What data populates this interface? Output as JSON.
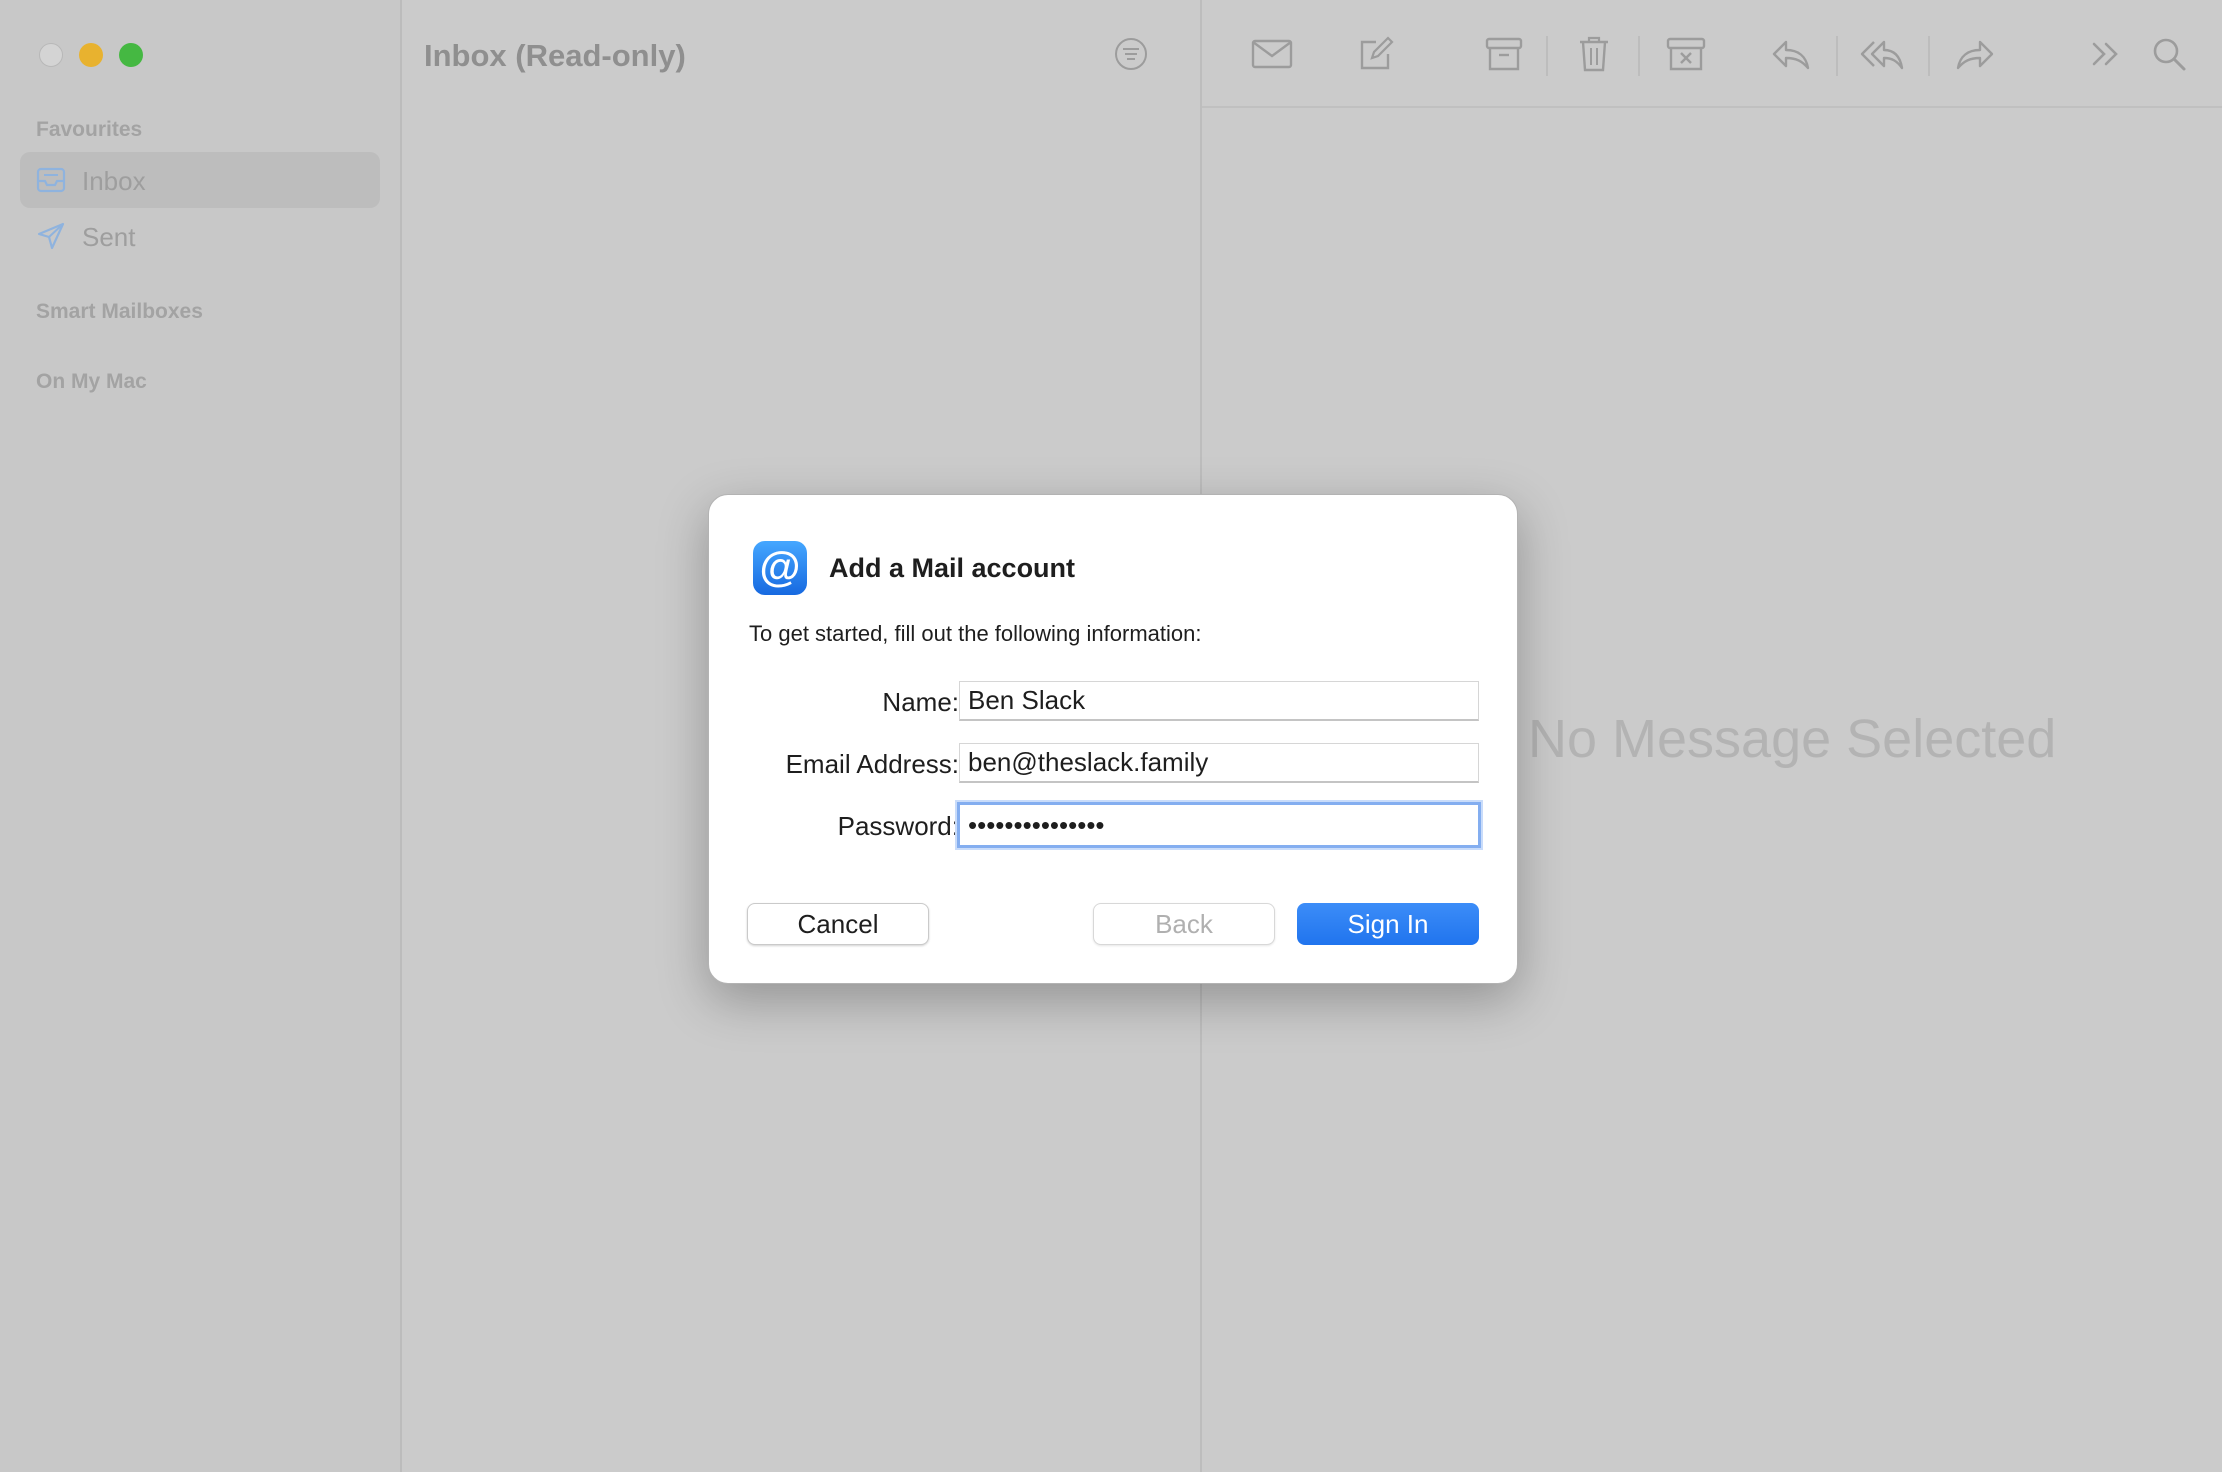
{
  "sidebar": {
    "sections": {
      "favourites": "Favourites",
      "smart_mailboxes": "Smart Mailboxes",
      "on_my_mac": "On My Mac"
    },
    "items": [
      {
        "label": "Inbox",
        "icon": "inbox-icon",
        "selected": true
      },
      {
        "label": "Sent",
        "icon": "paper-plane-icon",
        "selected": false
      }
    ]
  },
  "message_list": {
    "title": "Inbox (Read-only)"
  },
  "viewer": {
    "empty_text": "No Message Selected",
    "toolbar": [
      "get-mail-icon",
      "compose-icon",
      "archive-icon",
      "trash-icon",
      "junk-icon",
      "reply-icon",
      "reply-all-icon",
      "forward-icon",
      "more-icon",
      "search-icon"
    ]
  },
  "dialog": {
    "title": "Add a Mail account",
    "subtitle": "To get started, fill out the following information:",
    "fields": {
      "name_label": "Name:",
      "name_value": "Ben Slack",
      "email_label": "Email Address:",
      "email_value": "ben@theslack.family",
      "password_label": "Password:",
      "password_value": "•••••••••••••••"
    },
    "buttons": {
      "cancel": "Cancel",
      "back": "Back",
      "sign_in": "Sign In"
    }
  },
  "colors": {
    "accent": "#2F7FF3",
    "focus_ring": "#84AEF0",
    "window_bg": "#CBCBCB"
  }
}
